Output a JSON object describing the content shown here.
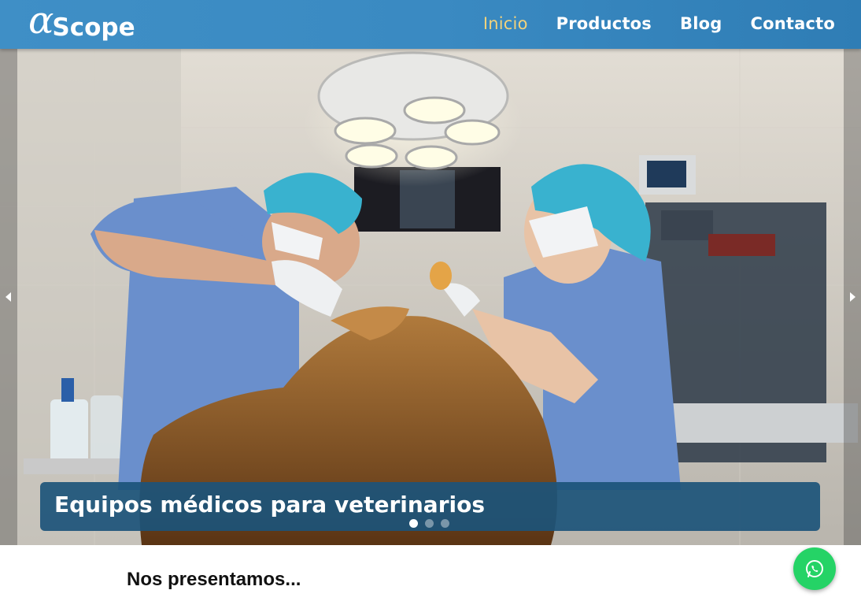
{
  "logo": {
    "alpha": "α",
    "text": "Scope"
  },
  "nav": {
    "items": [
      {
        "label": "Inicio",
        "active": true
      },
      {
        "label": "Productos",
        "active": false
      },
      {
        "label": "Blog",
        "active": false
      },
      {
        "label": "Contacto",
        "active": false
      }
    ]
  },
  "hero": {
    "caption": "Equipos médicos para veterinarios",
    "slide_count": 3,
    "active_slide": 1,
    "prev_icon": "chevron-left-icon",
    "next_icon": "chevron-right-icon"
  },
  "section": {
    "title": "Nos presentamos..."
  },
  "whatsapp": {
    "icon": "whatsapp-icon"
  },
  "colors": {
    "header": "#3a8ac2",
    "nav_active": "#f2d27c",
    "caption_bg": "#1c547a",
    "whatsapp": "#25d366"
  }
}
